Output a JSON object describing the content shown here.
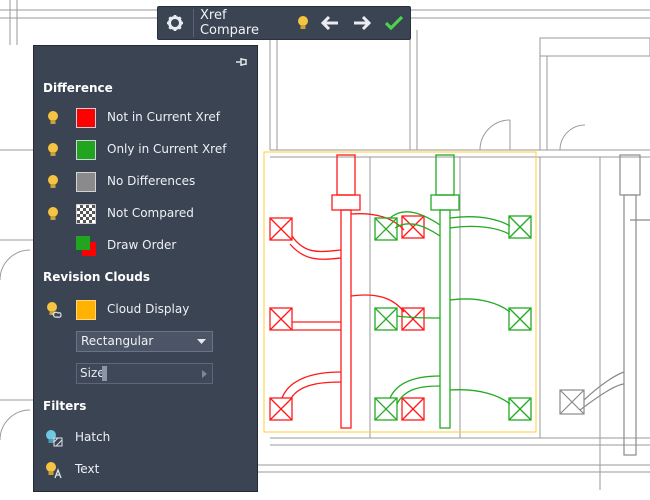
{
  "toolbar": {
    "title": "Xref Compare",
    "icons": [
      "gear-icon",
      "lightbulb-icon",
      "arrow-left-icon",
      "arrow-right-icon",
      "checkmark-icon"
    ]
  },
  "panel": {
    "difference_header": "Difference",
    "items": [
      {
        "label": "Not in Current Xref",
        "color": "#ff0000",
        "icon": "lightbulb-icon"
      },
      {
        "label": "Only in Current Xref",
        "color": "#21a521",
        "icon": "lightbulb-icon"
      },
      {
        "label": "No Differences",
        "color": "#8a8a8a",
        "icon": "lightbulb-icon"
      },
      {
        "label": "Not Compared",
        "color": "#checker",
        "icon": "lightbulb-icon"
      },
      {
        "label": "Draw Order",
        "color": "#draw-order",
        "icon": "draw-order-icon"
      }
    ],
    "revision_header": "Revision Clouds",
    "cloud_display_label": "Cloud Display",
    "cloud_color": "#ffb300",
    "shape_selected": "Rectangular",
    "size_label": "Size",
    "filters_header": "Filters",
    "hatch_label": "Hatch",
    "text_label": "Text"
  },
  "colors": {
    "panel_bg": "#3b4453",
    "red": "#ff0000",
    "green": "#21a521",
    "gray": "#8a8a8a",
    "cloud": "#ffcc33"
  }
}
